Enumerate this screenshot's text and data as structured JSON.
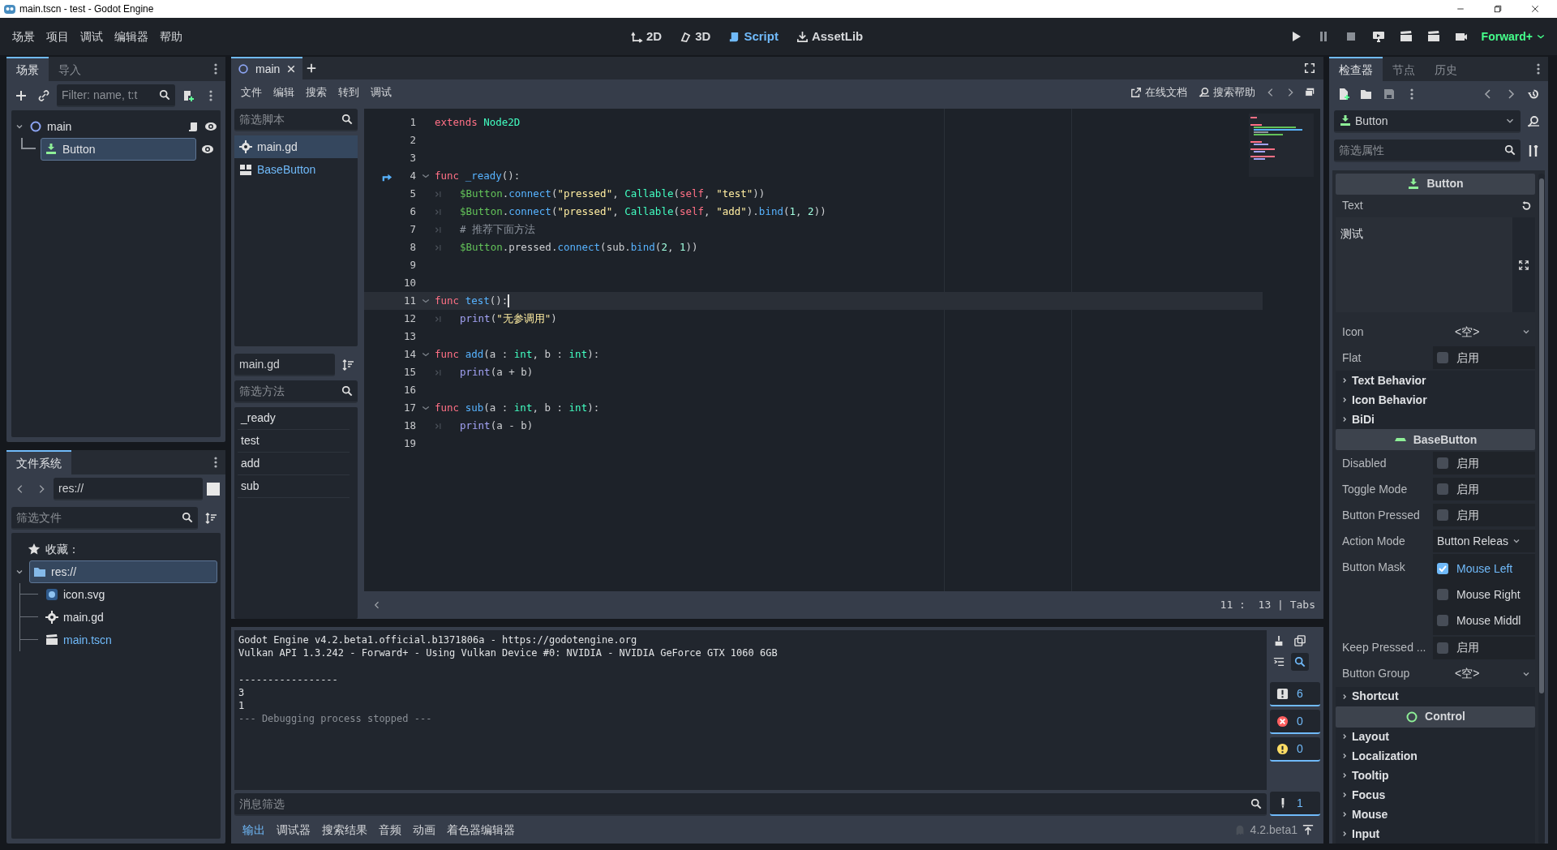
{
  "window": {
    "title": "main.tscn - test - Godot Engine"
  },
  "menu": [
    "场景",
    "项目",
    "调试",
    "编辑器",
    "帮助"
  ],
  "workspaces": [
    {
      "label": "2D",
      "selected": false
    },
    {
      "label": "3D",
      "selected": false
    },
    {
      "label": "Script",
      "selected": true
    },
    {
      "label": "AssetLib",
      "selected": false
    }
  ],
  "renderer": "Forward+",
  "scene_dock": {
    "tabs": [
      {
        "label": "场景",
        "selected": true
      },
      {
        "label": "导入",
        "selected": false
      }
    ],
    "filter": {
      "placeholder": "Filter: name, t:t"
    },
    "tree": [
      {
        "label": "main",
        "selected": false,
        "expanded": true,
        "children": [
          {
            "label": "Button",
            "selected": true
          }
        ]
      }
    ]
  },
  "filesystem": {
    "tabs": [
      {
        "label": "文件系统",
        "selected": true
      }
    ],
    "path": "res://",
    "filter": {
      "placeholder": "筛选文件"
    },
    "favorites": "收藏：",
    "tree": [
      {
        "label": "res://",
        "kind": "folder",
        "selected": true,
        "expanded": true,
        "open": false,
        "children": [
          {
            "label": "icon.svg",
            "kind": "image",
            "selected": false,
            "open": false
          },
          {
            "label": "main.gd",
            "kind": "script",
            "selected": false,
            "open": false
          },
          {
            "label": "main.tscn",
            "kind": "scene",
            "selected": false,
            "open": true
          }
        ]
      }
    ]
  },
  "script_editor": {
    "tabs": [
      {
        "label": "main",
        "selected": true
      }
    ],
    "menu": [
      "文件",
      "编辑",
      "搜索",
      "转到",
      "调试"
    ],
    "links": [
      "在线文档",
      "搜索帮助"
    ],
    "script_filter": {
      "placeholder": "筛选脚本"
    },
    "scripts": [
      {
        "label": "main.gd",
        "kind": "script",
        "selected": true
      },
      {
        "label": "BaseButton",
        "kind": "doc",
        "selected": false
      }
    ],
    "current_script": "main.gd",
    "method_filter": {
      "placeholder": "筛选方法"
    },
    "methods": [
      "_ready",
      "test",
      "add",
      "sub"
    ],
    "lines": [
      {
        "number": "1",
        "tokens": [
          {
            "kind": "keyword",
            "text": "extends"
          },
          {
            "kind": "type",
            "text": "Node2D",
            "spaced": true
          }
        ]
      },
      {
        "number": "2"
      },
      {
        "number": "3"
      },
      {
        "number": "4",
        "signal": true,
        "fold": true,
        "tokens": [
          {
            "kind": "keyword",
            "text": "func"
          },
          {
            "kind": "function",
            "text": "_ready",
            "spaced": true
          },
          {
            "kind": "plain",
            "text": "():"
          }
        ]
      },
      {
        "number": "5",
        "indent": true,
        "tokens": [
          {
            "kind": "node",
            "text": "$Button"
          },
          {
            "kind": "plain",
            "text": "."
          },
          {
            "kind": "method",
            "text": "connect"
          },
          {
            "kind": "plain",
            "text": "("
          },
          {
            "kind": "string",
            "text": "\"pressed\""
          },
          {
            "kind": "plain",
            "text": ", "
          },
          {
            "kind": "type",
            "text": "Callable"
          },
          {
            "kind": "plain",
            "text": "("
          },
          {
            "kind": "keyword",
            "text": "self"
          },
          {
            "kind": "plain",
            "text": ", "
          },
          {
            "kind": "string",
            "text": "\"test\""
          },
          {
            "kind": "plain",
            "text": "))"
          }
        ]
      },
      {
        "number": "6",
        "indent": true,
        "tokens": [
          {
            "kind": "node",
            "text": "$Button"
          },
          {
            "kind": "plain",
            "text": "."
          },
          {
            "kind": "method",
            "text": "connect"
          },
          {
            "kind": "plain",
            "text": "("
          },
          {
            "kind": "string",
            "text": "\"pressed\""
          },
          {
            "kind": "plain",
            "text": ", "
          },
          {
            "kind": "type",
            "text": "Callable"
          },
          {
            "kind": "plain",
            "text": "("
          },
          {
            "kind": "keyword",
            "text": "self"
          },
          {
            "kind": "plain",
            "text": ", "
          },
          {
            "kind": "string",
            "text": "\"add\""
          },
          {
            "kind": "plain",
            "text": ")."
          },
          {
            "kind": "method",
            "text": "bind"
          },
          {
            "kind": "plain",
            "text": "("
          },
          {
            "kind": "number",
            "text": "1"
          },
          {
            "kind": "plain",
            "text": ", "
          },
          {
            "kind": "number",
            "text": "2"
          },
          {
            "kind": "plain",
            "text": "))"
          }
        ]
      },
      {
        "number": "7",
        "indent": true,
        "tokens": [
          {
            "kind": "comment",
            "text": "# 推荐下面方法"
          }
        ]
      },
      {
        "number": "8",
        "indent": true,
        "tokens": [
          {
            "kind": "node",
            "text": "$Button"
          },
          {
            "kind": "plain",
            "text": ".pressed."
          },
          {
            "kind": "method",
            "text": "connect"
          },
          {
            "kind": "plain",
            "text": "(sub."
          },
          {
            "kind": "method",
            "text": "bind"
          },
          {
            "kind": "plain",
            "text": "("
          },
          {
            "kind": "number",
            "text": "2"
          },
          {
            "kind": "plain",
            "text": ", "
          },
          {
            "kind": "number",
            "text": "1"
          },
          {
            "kind": "plain",
            "text": "))"
          }
        ]
      },
      {
        "number": "9"
      },
      {
        "number": "10"
      },
      {
        "number": "11",
        "fold": true,
        "current": true,
        "tokens": [
          {
            "kind": "keyword",
            "text": "func"
          },
          {
            "kind": "function",
            "text": "test",
            "spaced": true
          },
          {
            "kind": "plain",
            "text": "():"
          }
        ]
      },
      {
        "number": "12",
        "indent": true,
        "tokens": [
          {
            "kind": "builtin",
            "text": "print"
          },
          {
            "kind": "plain",
            "text": "("
          },
          {
            "kind": "string",
            "text": "\"无参调用\""
          },
          {
            "kind": "plain",
            "text": ")"
          }
        ]
      },
      {
        "number": "13"
      },
      {
        "number": "14",
        "fold": true,
        "tokens": [
          {
            "kind": "keyword",
            "text": "func"
          },
          {
            "kind": "function",
            "text": "add",
            "spaced": true
          },
          {
            "kind": "plain",
            "text": "(a : "
          },
          {
            "kind": "type",
            "text": "int"
          },
          {
            "kind": "plain",
            "text": ", b : "
          },
          {
            "kind": "type",
            "text": "int"
          },
          {
            "kind": "plain",
            "text": "):"
          }
        ]
      },
      {
        "number": "15",
        "indent": true,
        "tokens": [
          {
            "kind": "builtin",
            "text": "print"
          },
          {
            "kind": "plain",
            "text": "(a + b)"
          }
        ]
      },
      {
        "number": "16"
      },
      {
        "number": "17",
        "fold": true,
        "tokens": [
          {
            "kind": "keyword",
            "text": "func"
          },
          {
            "kind": "function",
            "text": "sub",
            "spaced": true
          },
          {
            "kind": "plain",
            "text": "(a : "
          },
          {
            "kind": "type",
            "text": "int"
          },
          {
            "kind": "plain",
            "text": ", b : "
          },
          {
            "kind": "type",
            "text": "int"
          },
          {
            "kind": "plain",
            "text": "):"
          }
        ]
      },
      {
        "number": "18",
        "indent": true,
        "tokens": [
          {
            "kind": "builtin",
            "text": "print"
          },
          {
            "kind": "plain",
            "text": "(a - b)"
          }
        ]
      },
      {
        "number": "19"
      }
    ],
    "status": "11 :  13 | Tabs"
  },
  "output": {
    "lines": [
      {
        "text": "Godot Engine v4.2.beta1.official.b1371806a - https://godotengine.org",
        "kind": "normal"
      },
      {
        "text": "Vulkan API 1.3.242 - Forward+ - Using Vulkan Device #0: NVIDIA - NVIDIA GeForce GTX 1060 6GB",
        "kind": "normal"
      },
      {
        "text": "-----------------",
        "kind": "normal",
        "gap_before": true
      },
      {
        "text": "3",
        "kind": "normal"
      },
      {
        "text": "1",
        "kind": "normal"
      },
      {
        "text": "--- Debugging process stopped ---",
        "kind": "dim"
      }
    ],
    "filter": {
      "placeholder": "消息筛选"
    },
    "counters": [
      {
        "kind": "message",
        "count": "6"
      },
      {
        "kind": "error",
        "count": "0"
      },
      {
        "kind": "warning",
        "count": "0"
      },
      {
        "kind": "editor",
        "count": "1"
      }
    ]
  },
  "bottom_tabs": [
    {
      "label": "输出",
      "selected": true
    },
    {
      "label": "调试器",
      "selected": false
    },
    {
      "label": "搜索结果",
      "selected": false
    },
    {
      "label": "音频",
      "selected": false
    },
    {
      "label": "动画",
      "selected": false
    },
    {
      "label": "着色器编辑器",
      "selected": false
    }
  ],
  "version": "4.2.beta1",
  "inspector": {
    "tabs": [
      {
        "label": "检查器",
        "selected": true
      },
      {
        "label": "节点",
        "selected": false
      },
      {
        "label": "历史",
        "selected": false
      }
    ],
    "object": "Button",
    "filter": {
      "placeholder": "筛选属性"
    },
    "sections": [
      {
        "title": "Button",
        "rows": [
          {
            "kind": "text",
            "label": "Text",
            "value": "测试"
          },
          {
            "kind": "resource",
            "label": "Icon",
            "value": "<空>"
          },
          {
            "kind": "check",
            "label": "Flat",
            "value": "启用",
            "checked": false
          },
          {
            "kind": "group",
            "label": "Text Behavior"
          },
          {
            "kind": "group",
            "label": "Icon Behavior"
          },
          {
            "kind": "group",
            "label": "BiDi"
          }
        ]
      },
      {
        "title": "BaseButton",
        "rows": [
          {
            "kind": "check",
            "label": "Disabled",
            "value": "启用",
            "checked": false
          },
          {
            "kind": "check",
            "label": "Toggle Mode",
            "value": "启用",
            "checked": false
          },
          {
            "kind": "check",
            "label": "Button Pressed",
            "value": "启用",
            "checked": false
          },
          {
            "kind": "enum",
            "label": "Action Mode",
            "value": "Button Releas"
          },
          {
            "kind": "flags",
            "label": "Button Mask",
            "options": [
              {
                "label": "Mouse Left",
                "checked": true
              },
              {
                "label": "Mouse Right",
                "checked": false
              },
              {
                "label": "Mouse Middl",
                "checked": false
              }
            ]
          },
          {
            "kind": "check",
            "label": "Keep Pressed ...",
            "value": "启用",
            "checked": false
          },
          {
            "kind": "resource",
            "label": "Button Group",
            "value": "<空>"
          },
          {
            "kind": "group",
            "label": "Shortcut"
          }
        ]
      },
      {
        "title": "Control",
        "rows": [
          {
            "kind": "group",
            "label": "Layout"
          },
          {
            "kind": "group",
            "label": "Localization"
          },
          {
            "kind": "group",
            "label": "Tooltip"
          },
          {
            "kind": "group",
            "label": "Focus"
          },
          {
            "kind": "group",
            "label": "Mouse"
          },
          {
            "kind": "group",
            "label": "Input"
          }
        ]
      }
    ]
  }
}
